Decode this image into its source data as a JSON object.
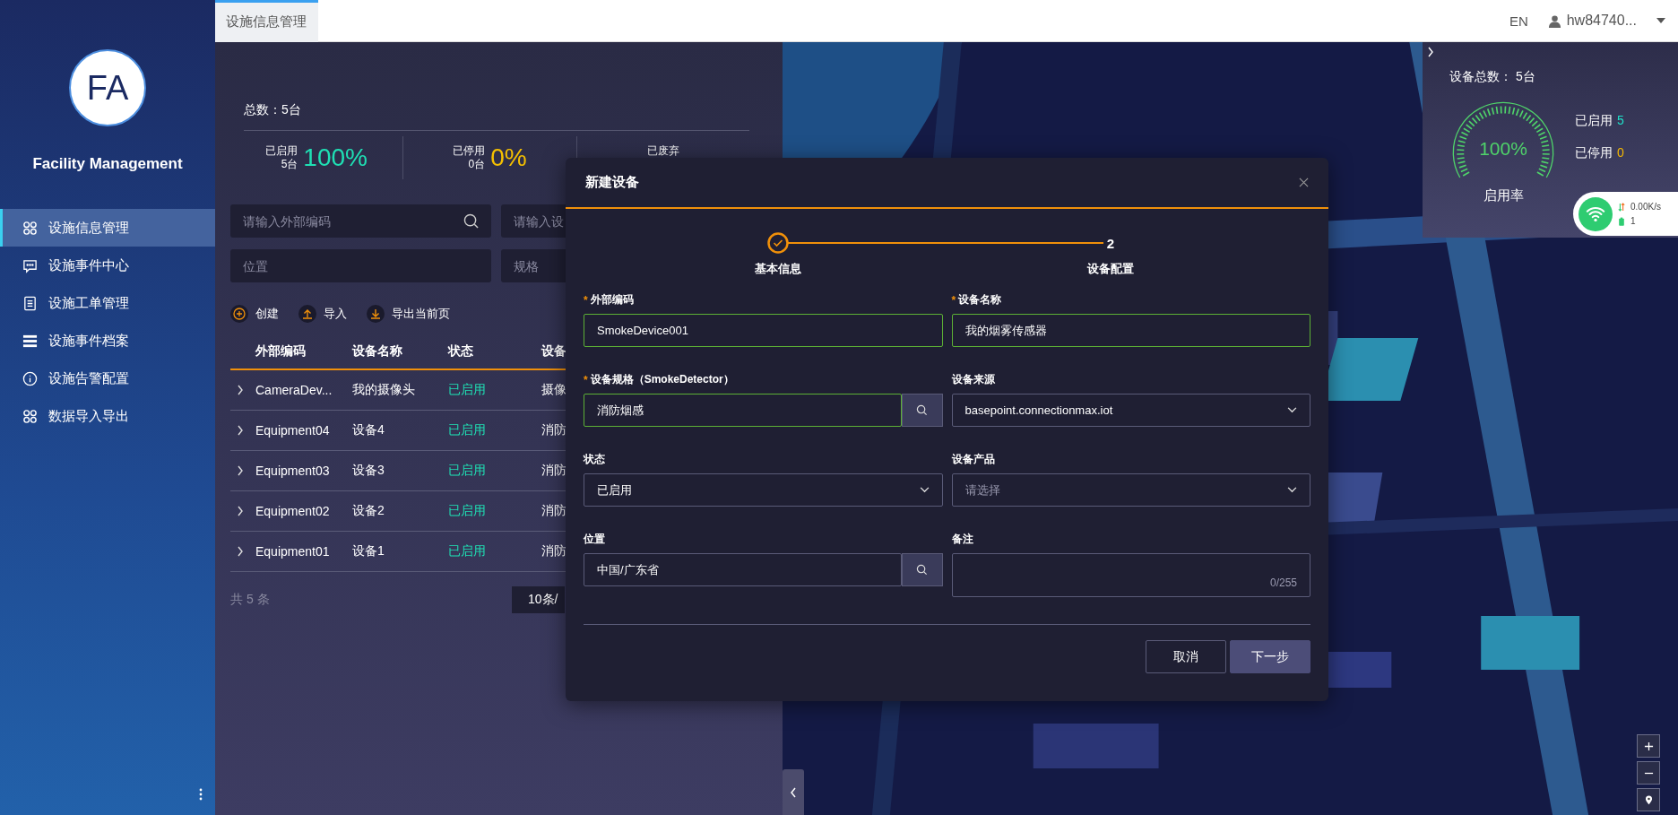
{
  "sidebar": {
    "logo": "FA",
    "title": "Facility Management",
    "items": [
      {
        "label": "设施信息管理",
        "selected": true
      },
      {
        "label": "设施事件中心",
        "selected": false
      },
      {
        "label": "设施工单管理",
        "selected": false
      },
      {
        "label": "设施事件档案",
        "selected": false
      },
      {
        "label": "设施告警配置",
        "selected": false
      },
      {
        "label": "数据导入导出",
        "selected": false
      }
    ]
  },
  "tabs": [
    {
      "label": "设施信息管理",
      "selected": true
    }
  ],
  "header": {
    "language": "EN",
    "user": "hw84740..."
  },
  "summary": {
    "total": "总数：5台",
    "stats": [
      {
        "label": "已启用",
        "count": "5台",
        "percent": "100%",
        "color": "#1fe0b4"
      },
      {
        "label": "已停用",
        "count": "0台",
        "percent": "0%",
        "color": "#f5c000"
      },
      {
        "label": "已废弃"
      }
    ]
  },
  "filters": [
    {
      "placeholder": "请输入外部编码",
      "kind": "search"
    },
    {
      "placeholder": "请输入设",
      "kind": "text"
    },
    {
      "placeholder": "位置",
      "kind": "text"
    },
    {
      "placeholder": "规格",
      "kind": "text"
    }
  ],
  "actions": [
    {
      "label": "创建"
    },
    {
      "label": "导入"
    },
    {
      "label": "导出当前页"
    }
  ],
  "table": {
    "columns": [
      "外部编码",
      "设备名称",
      "状态",
      "设备"
    ],
    "rows": [
      {
        "code": "CameraDev...",
        "name": "我的摄像头",
        "status": "已启用",
        "spec": "摄像"
      },
      {
        "code": "Equipment04",
        "name": "设备4",
        "status": "已启用",
        "spec": "消防"
      },
      {
        "code": "Equipment03",
        "name": "设备3",
        "status": "已启用",
        "spec": "消防"
      },
      {
        "code": "Equipment02",
        "name": "设备2",
        "status": "已启用",
        "spec": "消防"
      },
      {
        "code": "Equipment01",
        "name": "设备1",
        "status": "已启用",
        "spec": "消防"
      }
    ]
  },
  "pagination": {
    "total": "共 5 条",
    "page_size": "10条/"
  },
  "dialog": {
    "title": "新建设备",
    "steps": [
      {
        "label": "基本信息",
        "done": true
      },
      {
        "label": "设备配置",
        "number": "2",
        "done": false
      }
    ],
    "fields": [
      {
        "mark": "*",
        "label": "外部编码",
        "kind": "input",
        "value": "SmokeDevice001",
        "valid": true
      },
      {
        "mark": "*",
        "label": "设备名称",
        "kind": "input",
        "value": "我的烟雾传感器",
        "valid": true
      },
      {
        "mark": "*",
        "label": "设备规格（SmokeDetector）",
        "kind": "search",
        "value": "消防烟感",
        "valid": true
      },
      {
        "label": "设备来源",
        "kind": "select",
        "value": "basepoint.connectionmax.iot",
        "valid": false
      },
      {
        "label": "状态",
        "kind": "select",
        "value": "已启用",
        "valid": false
      },
      {
        "label": "设备产品",
        "kind": "select",
        "placeholder": "请选择",
        "valid": false
      },
      {
        "label": "位置",
        "kind": "search",
        "value": "中国/广东省",
        "valid": false
      },
      {
        "label": "备注",
        "kind": "textarea",
        "counter": "0/255",
        "valid": false
      }
    ],
    "buttons": [
      {
        "label": "取消",
        "primary": false
      },
      {
        "label": "下一步",
        "primary": true
      }
    ]
  },
  "map_panel": {
    "total": "设备总数： 5台",
    "gauge": {
      "value": "100%",
      "label": "启用率"
    },
    "stats": [
      {
        "label": "已启用",
        "value": "5",
        "color": "#1fe0c8"
      },
      {
        "label": "已停用",
        "value": "0",
        "color": "#f5b800"
      }
    ]
  },
  "network": {
    "speed": "0.00K/s",
    "count": "1"
  }
}
